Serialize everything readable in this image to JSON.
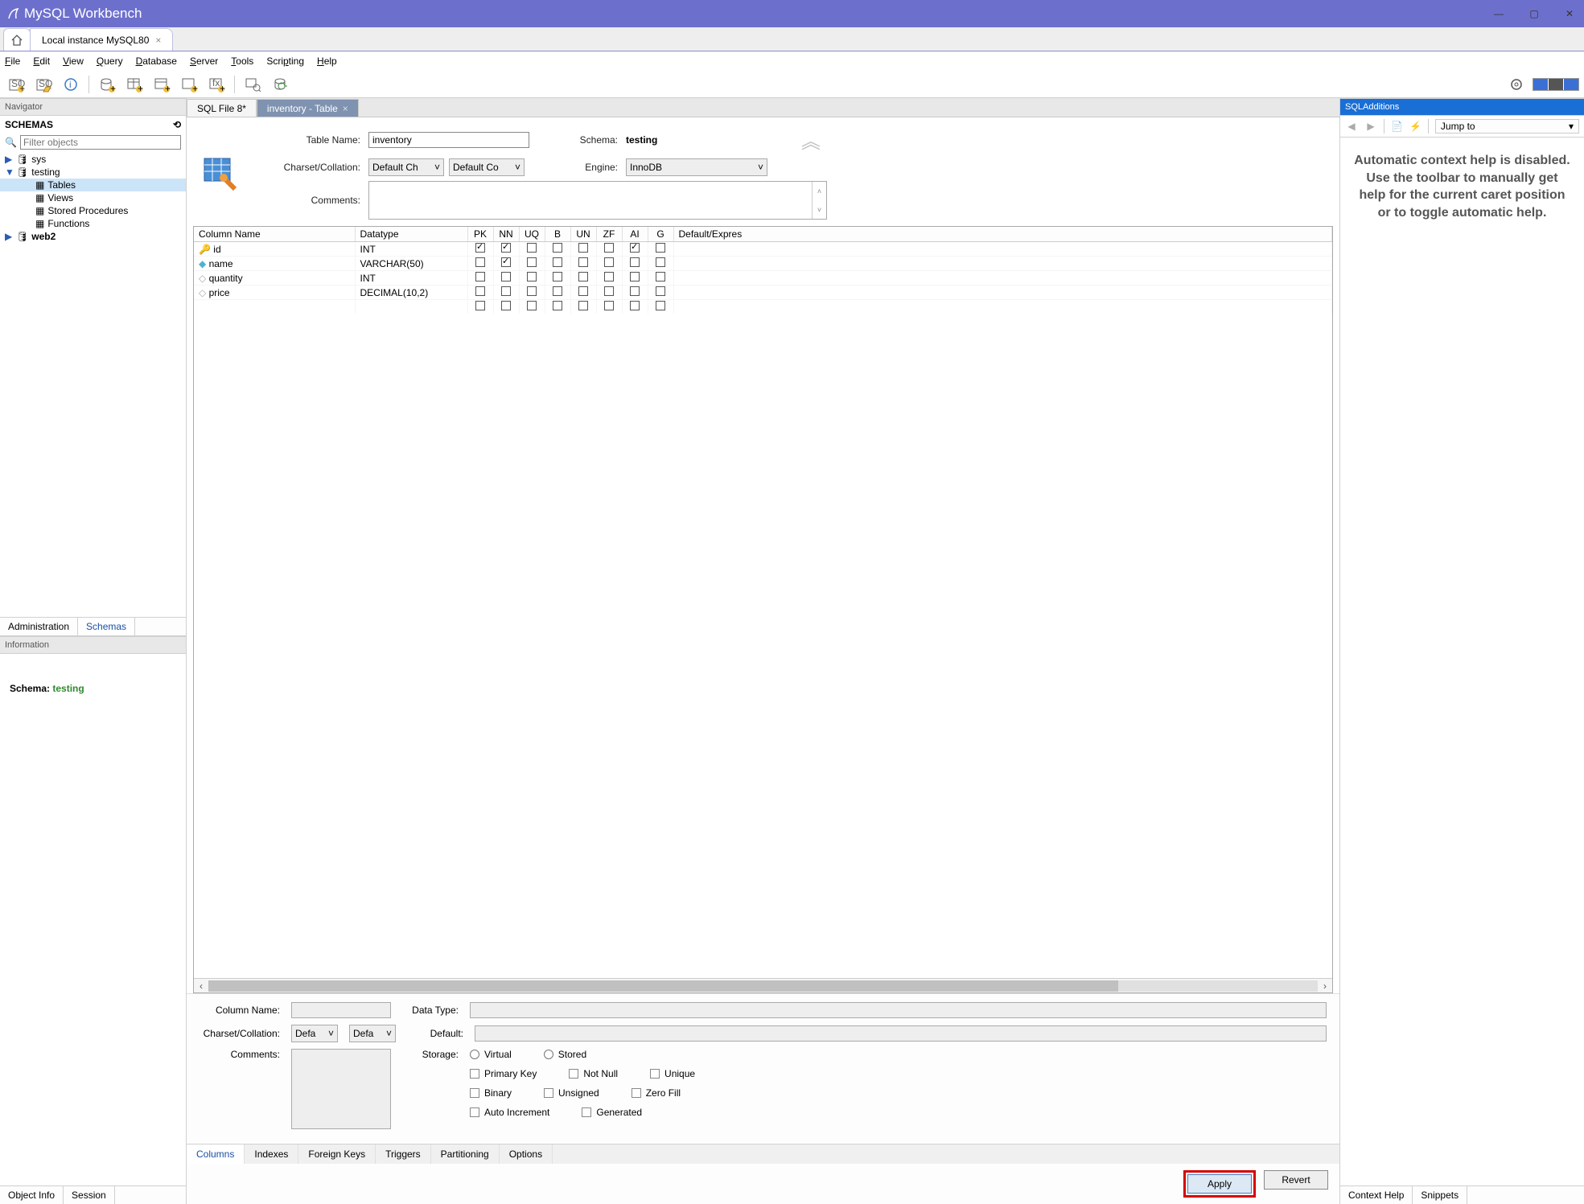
{
  "app_title": "MySQL Workbench",
  "connection_tab": "Local instance MySQL80",
  "menu": [
    "File",
    "Edit",
    "View",
    "Query",
    "Database",
    "Server",
    "Tools",
    "Scripting",
    "Help"
  ],
  "navigator": {
    "title": "Navigator",
    "schemas_label": "SCHEMAS",
    "filter_placeholder": "Filter objects",
    "tree": {
      "sys": "sys",
      "testing": "testing",
      "tables": "Tables",
      "views": "Views",
      "stored_procedures": "Stored Procedures",
      "functions": "Functions",
      "web2": "web2"
    },
    "tabs": {
      "administration": "Administration",
      "schemas": "Schemas"
    }
  },
  "information": {
    "title": "Information",
    "schema_label": "Schema:",
    "schema_value": "testing",
    "tabs": {
      "object_info": "Object Info",
      "session": "Session"
    }
  },
  "editor_tabs": {
    "sql_file": "SQL File 8*",
    "inventory": "inventory - Table"
  },
  "table_editor": {
    "table_name_label": "Table Name:",
    "table_name_value": "inventory",
    "schema_label": "Schema:",
    "schema_value": "testing",
    "charset_label": "Charset/Collation:",
    "charset_value": "Default Ch",
    "collation_value": "Default Co",
    "engine_label": "Engine:",
    "engine_value": "InnoDB",
    "comments_label": "Comments:"
  },
  "columns": {
    "headers": {
      "name": "Column Name",
      "datatype": "Datatype",
      "pk": "PK",
      "nn": "NN",
      "uq": "UQ",
      "b": "B",
      "un": "UN",
      "zf": "ZF",
      "ai": "AI",
      "g": "G",
      "default": "Default/Expres"
    },
    "rows": [
      {
        "icon": "key",
        "name": "id",
        "datatype": "INT",
        "pk": true,
        "nn": true,
        "uq": false,
        "b": false,
        "un": false,
        "zf": false,
        "ai": true,
        "g": false
      },
      {
        "icon": "diamond",
        "name": "name",
        "datatype": "VARCHAR(50)",
        "pk": false,
        "nn": true,
        "uq": false,
        "b": false,
        "un": false,
        "zf": false,
        "ai": false,
        "g": false
      },
      {
        "icon": "diamond-empty",
        "name": "quantity",
        "datatype": "INT",
        "pk": false,
        "nn": false,
        "uq": false,
        "b": false,
        "un": false,
        "zf": false,
        "ai": false,
        "g": false
      },
      {
        "icon": "diamond-empty",
        "name": "price",
        "datatype": "DECIMAL(10,2)",
        "pk": false,
        "nn": false,
        "uq": false,
        "b": false,
        "un": false,
        "zf": false,
        "ai": false,
        "g": false
      }
    ]
  },
  "col_detail": {
    "column_name_label": "Column Name:",
    "datatype_label": "Data Type:",
    "charset_label": "Charset/Collation:",
    "charset_value": "Defa",
    "collation_value": "Defa",
    "default_label": "Default:",
    "comments_label": "Comments:",
    "storage_label": "Storage:",
    "virtual": "Virtual",
    "stored": "Stored",
    "pk": "Primary Key",
    "nn": "Not Null",
    "uq": "Unique",
    "bin": "Binary",
    "un": "Unsigned",
    "zf": "Zero Fill",
    "ai": "Auto Increment",
    "gen": "Generated"
  },
  "editor_bottom_tabs": [
    "Columns",
    "Indexes",
    "Foreign Keys",
    "Triggers",
    "Partitioning",
    "Options"
  ],
  "buttons": {
    "apply": "Apply",
    "revert": "Revert"
  },
  "right_panel": {
    "title": "SQLAdditions",
    "jump_to": "Jump to",
    "help_text": "Automatic context help is disabled. Use the toolbar to manually get help for the current caret position or to toggle automatic help.",
    "tabs": {
      "context_help": "Context Help",
      "snippets": "Snippets"
    }
  }
}
